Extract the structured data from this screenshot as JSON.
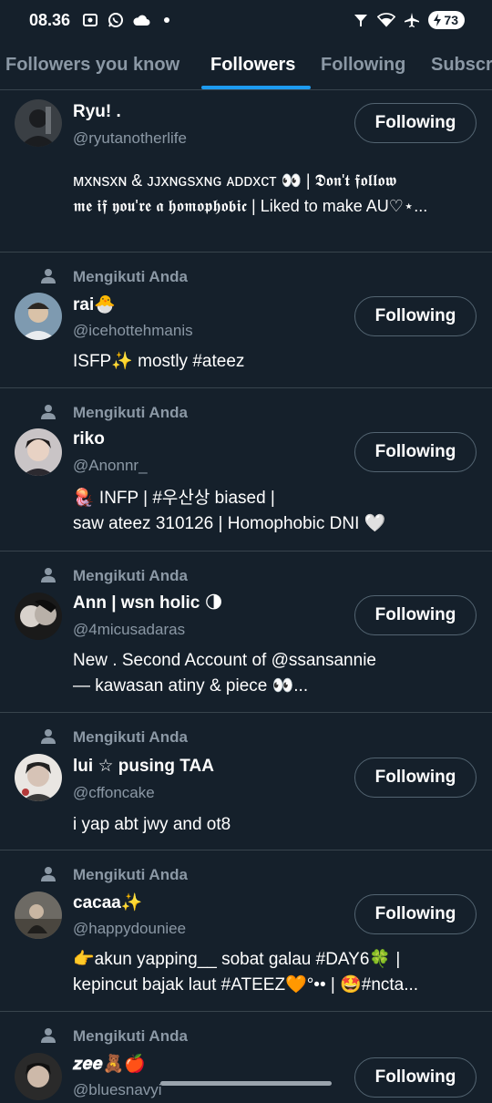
{
  "status_bar": {
    "time": "08.36",
    "battery": "73",
    "left_icons": [
      "screenshot-icon",
      "whatsapp-icon",
      "cloud-icon",
      "dot-icon"
    ],
    "right_icons": [
      "signal-icon",
      "wifi-icon",
      "airplane-icon",
      "battery-icon"
    ]
  },
  "tabs": [
    {
      "label": "Followers you know",
      "active": false
    },
    {
      "label": "Followers",
      "active": true
    },
    {
      "label": "Following",
      "active": false
    },
    {
      "label": "Subscri",
      "active": false
    }
  ],
  "follows_you_label": "Mengikuti Anda",
  "follow_button_label": "Following",
  "users": [
    {
      "name": "Ryu! .",
      "handle": "@ryutanotherlife",
      "follows_you": false,
      "bio": "ᴍxɴsxɴ & ᴊᴊxɴɢsxɴɢ ᴀᴅᴅxᴄᴛ 👀 | 𝕯𝖔𝖓'𝖙 𝖋𝖔𝖑𝖑𝖔𝖜\n𝖒𝖊 𝖎𝖋 𝖞𝖔𝖚'𝖗𝖊 𝖆 𝖍𝖔𝖒𝖔𝖕𝖍𝖔𝖇𝖎𝖈 | Liked to make AU♡⋆..."
    },
    {
      "name": "rai🐣",
      "handle": "@icehottehmanis",
      "follows_you": true,
      "bio": "ISFP✨ mostly #ateez"
    },
    {
      "name": "riko",
      "handle": "@Anonnr_",
      "follows_you": true,
      "bio": "🪼 INFP | #우산상 biased  |\nsaw ateez 310126 | Homophobic DNI 🤍"
    },
    {
      "name": "Ann | wsn holic 🌗",
      "handle": "@4micusadaras",
      "follows_you": true,
      "bio": "New . Second Account of @ssansannie\n— kawasan atiny & piece 👀..."
    },
    {
      "name": "lui ☆ pusing TAA",
      "handle": "@cffoncake",
      "follows_you": true,
      "bio": "i yap abt jwy and ot8"
    },
    {
      "name": "cacaa✨",
      "handle": "@happydouniee",
      "follows_you": true,
      "bio": "👉akun yapping__ sobat galau #DAY6🍀 |\nkepincut bajak laut #ATEEZ🧡°•• | 🤩#ncta..."
    },
    {
      "name": "𝒛𝒆𝒆🧸🍎",
      "handle": "@bluesnavyi",
      "follows_you": true,
      "bio": ""
    }
  ]
}
